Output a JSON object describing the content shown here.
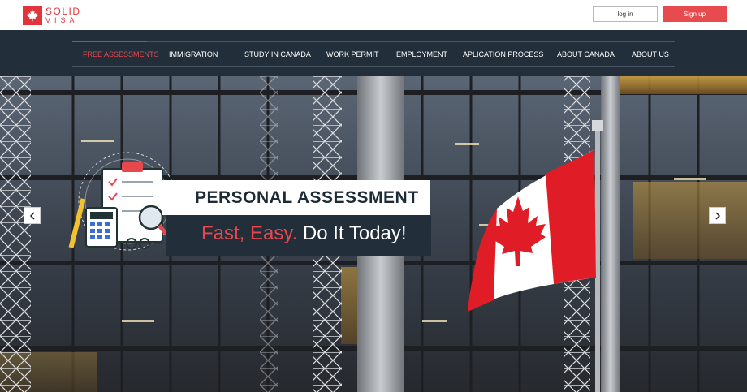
{
  "header": {
    "logo": {
      "line1": "SOLID",
      "line2": "VISA"
    },
    "login_label": "log in",
    "signup_label": "Sign up"
  },
  "nav": {
    "items": [
      {
        "label": "FREE ASSESSMENTS",
        "active": true
      },
      {
        "label": "IMMIGRATION",
        "active": false
      },
      {
        "label": "STUDY IN CANADA",
        "active": false
      },
      {
        "label": "WORK PERMIT",
        "active": false
      },
      {
        "label": "EMPLOYMENT",
        "active": false
      },
      {
        "label": "APLICATION PROCESS",
        "active": false
      },
      {
        "label": "ABOUT CANADA",
        "active": false
      },
      {
        "label": "ABOUT US",
        "active": false
      }
    ]
  },
  "hero": {
    "title": "PERSONAL  ASSESSMENT",
    "subtitle_highlight": "Fast, Easy.",
    "subtitle_rest": " Do It Today!",
    "prev_icon": "chevron-left-icon",
    "next_icon": "chevron-right-icon",
    "illustration_icon": "assessment-clipboard-icon",
    "flag_icon": "canada-flag-icon"
  },
  "colors": {
    "brand_red": "#e2353b",
    "nav_bg": "#222f3b",
    "signup_bg": "#e74b4f",
    "active_nav": "#e8484d"
  }
}
